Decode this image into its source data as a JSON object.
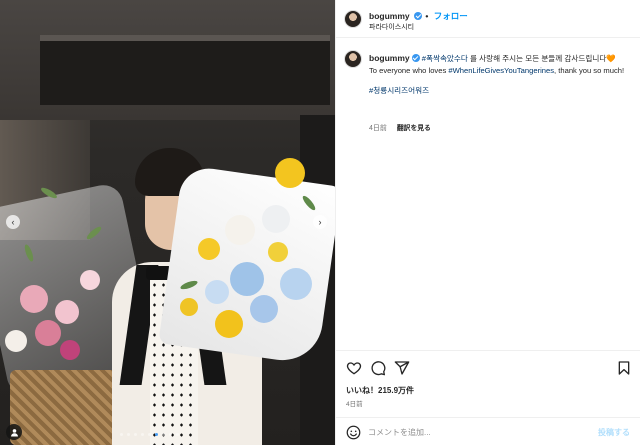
{
  "account": {
    "username": "bogummy",
    "follow_label": "フォロー",
    "separator": "•",
    "location": "파라다이스시티"
  },
  "caption": {
    "username": "bogummy",
    "hashtag_show_ko": "#폭싹속았수다",
    "text_ko": " 를 사랑해 주시는 모든 분들께 감사드립니다",
    "heart": "🧡",
    "text_en_prefix": "To everyone who loves ",
    "hashtag_show_en": "#WhenLifeGivesYouTangerines",
    "text_en_suffix": ", thank you so much!",
    "hashtag_series": "#청룡시리즈어워즈",
    "time_ago": "4日前",
    "translate_label": "翻訳を見る"
  },
  "actions": {
    "likes": "いいね！215.9万件",
    "date": "4日前"
  },
  "comment": {
    "placeholder": "コメントを追加...",
    "post_label": "投稿する"
  },
  "carousel": {
    "prev_glyph": "‹",
    "next_glyph": "›",
    "slide_count": 9,
    "active_index": 5
  },
  "colors": {
    "accent": "#0095f6",
    "verified": "#3897f0",
    "hashtag": "#00376b",
    "post_disabled": "#b2dffc",
    "heart": "#f77737"
  },
  "icons": {
    "like": "heart-icon",
    "comment": "comment-icon",
    "share": "paper-plane-icon",
    "save": "bookmark-icon",
    "emoji": "emoji-icon",
    "verified": "verified-badge-icon",
    "tag": "person-tag-icon"
  }
}
